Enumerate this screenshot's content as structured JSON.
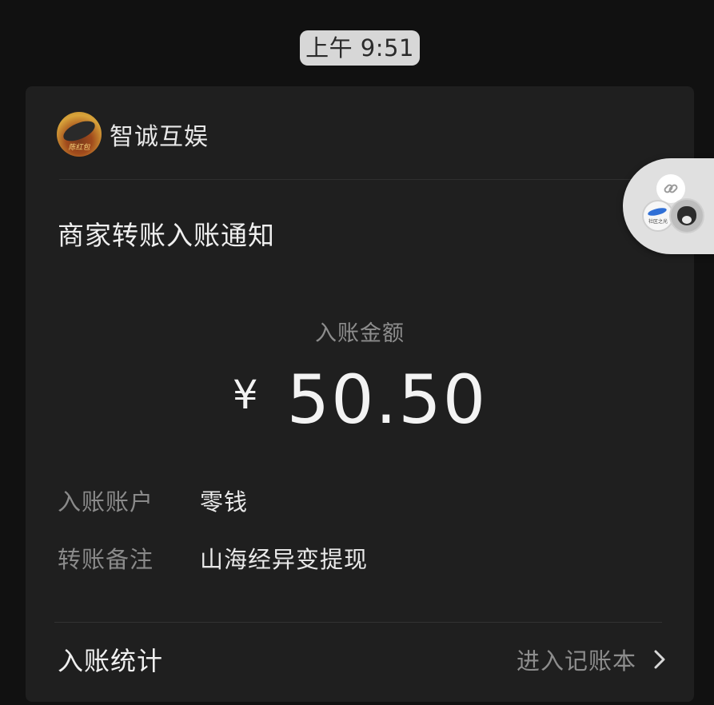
{
  "status": {
    "time": "上午 9:51"
  },
  "notification": {
    "sender": {
      "name": "智诚互娱",
      "avatar_text": "陈红包"
    },
    "title": "商家转账入账通知",
    "amount_label": "入账金额",
    "currency": "¥",
    "amount": "50.50",
    "details": [
      {
        "label": "入账账户",
        "value": "零钱"
      },
      {
        "label": "转账备注",
        "value": "山海经异变提现"
      }
    ],
    "footer": {
      "left": "入账统计",
      "right": "进入记账本"
    }
  },
  "floating_widget": {
    "link_icon": "link-icon",
    "left_icon_text": "社区之光"
  },
  "colors": {
    "background": "#111111",
    "card": "#1f1f1f",
    "primary_text": "#efefef",
    "secondary_text": "#8a8a8a"
  }
}
